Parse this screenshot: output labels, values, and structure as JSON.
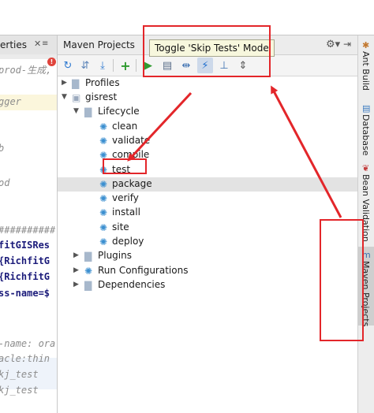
{
  "editor": {
    "tab_label": "erties",
    "tab_close": "✕",
    "tab_menu": "≡",
    "lines": [
      "prod-生成,",
      "gger",
      "b",
      "od",
      "##########",
      "fitGISRes",
      "{RichfitG",
      "{RichfitG",
      "ss-name=$",
      "-name: ora",
      "acle:thin",
      "kj_test",
      "kj_test"
    ]
  },
  "maven": {
    "title": "Maven Projects",
    "tooltip": "Toggle 'Skip Tests' Mode",
    "toolbar": [
      {
        "name": "reimport-icon",
        "glyph": "↻"
      },
      {
        "name": "generate-sources-icon",
        "glyph": "⇵"
      },
      {
        "name": "download-icon",
        "glyph": "⤓"
      },
      {
        "name": "add-icon",
        "glyph": "+"
      },
      {
        "name": "run-icon",
        "glyph": "▶"
      },
      {
        "name": "execute-goal-icon",
        "glyph": "▤"
      },
      {
        "name": "toggle-offline-icon",
        "glyph": "⇹"
      },
      {
        "name": "skip-tests-icon",
        "glyph": "⚡"
      },
      {
        "name": "show-dependencies-icon",
        "glyph": "⊥"
      },
      {
        "name": "collapse-all-icon",
        "glyph": "⇕"
      }
    ],
    "tree": {
      "profiles": "Profiles",
      "project": "gisrest",
      "lifecycle": "Lifecycle",
      "phases": [
        "clean",
        "validate",
        "compile",
        "test",
        "package",
        "verify",
        "install",
        "site",
        "deploy"
      ],
      "plugins": "Plugins",
      "run_configs": "Run Configurations",
      "dependencies": "Dependencies"
    }
  },
  "side_tabs": [
    "Ant Build",
    "Database",
    "Bean Validation",
    "Maven Projects"
  ],
  "colors": {
    "annotation_red": "#e3262a",
    "selection": "#e3e3e3",
    "tooltip_bg": "#f7f7dd",
    "gear_blue": "#3b8fd0"
  }
}
